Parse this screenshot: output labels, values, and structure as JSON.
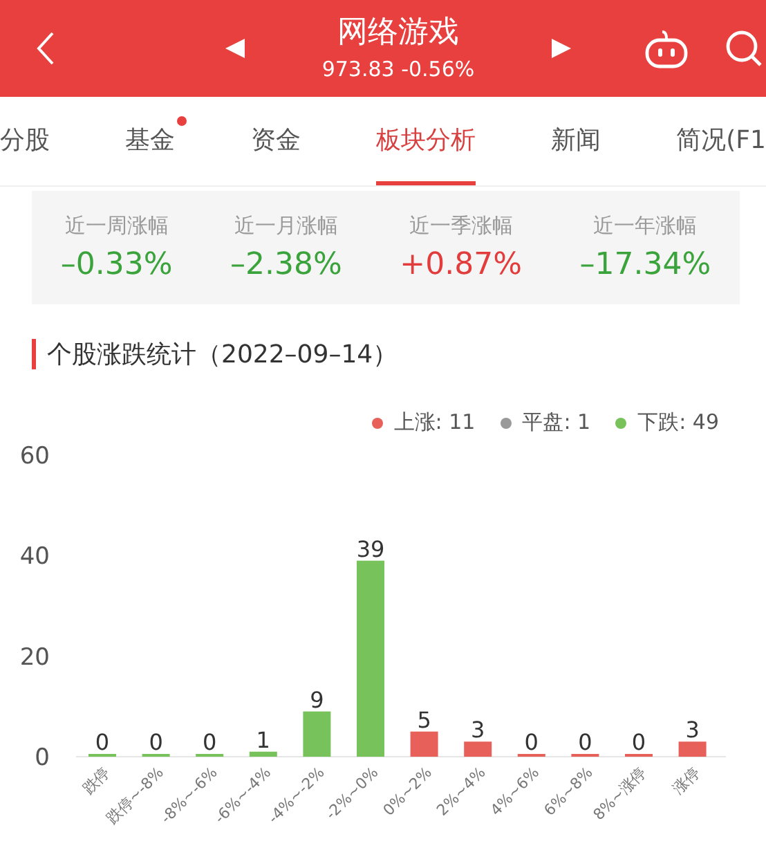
{
  "header": {
    "title": "网络游戏",
    "quote": "973.83 -0.56%"
  },
  "tabs": [
    {
      "label": "分股",
      "selected": false,
      "dot": false
    },
    {
      "label": "基金",
      "selected": false,
      "dot": true
    },
    {
      "label": "资金",
      "selected": false,
      "dot": false
    },
    {
      "label": "板块分析",
      "selected": true,
      "dot": false
    },
    {
      "label": "新闻",
      "selected": false,
      "dot": false
    },
    {
      "label": "简况(F1",
      "selected": false,
      "dot": false
    }
  ],
  "stats": [
    {
      "label": "近一周涨幅",
      "value": "–0.33%",
      "color": "#3ba33b"
    },
    {
      "label": "近一月涨幅",
      "value": "–2.38%",
      "color": "#3ba33b"
    },
    {
      "label": "近一季涨幅",
      "value": "+0.87%",
      "color": "#e23c3c"
    },
    {
      "label": "近一年涨幅",
      "value": "–17.34%",
      "color": "#3ba33b"
    }
  ],
  "section_title": "个股涨跌统计（2022–09–14）",
  "chart_data": {
    "type": "bar",
    "categories": [
      "跌停",
      "跌停~-8%",
      "-8%~-6%",
      "-6%~-4%",
      "-4%~-2%",
      "-2%~0%",
      "0%~2%",
      "2%~4%",
      "4%~6%",
      "6%~8%",
      "8%~涨停",
      "涨停"
    ],
    "series": [
      {
        "name": "上涨: 11",
        "color": "#e8605a",
        "values": [
          null,
          null,
          null,
          null,
          null,
          null,
          5,
          3,
          0,
          0,
          0,
          3
        ]
      },
      {
        "name": "平盘: 1",
        "color": "#999999",
        "values": [
          null,
          null,
          null,
          null,
          null,
          null,
          null,
          null,
          null,
          null,
          null,
          null
        ]
      },
      {
        "name": "下跌: 49",
        "color": "#77c25a",
        "values": [
          0,
          0,
          0,
          1,
          9,
          39,
          null,
          null,
          null,
          null,
          null,
          null
        ]
      }
    ],
    "stacked": true,
    "ylim": [
      0,
      60
    ],
    "yticks": [
      0,
      20,
      40,
      60
    ],
    "data_labels": true
  }
}
